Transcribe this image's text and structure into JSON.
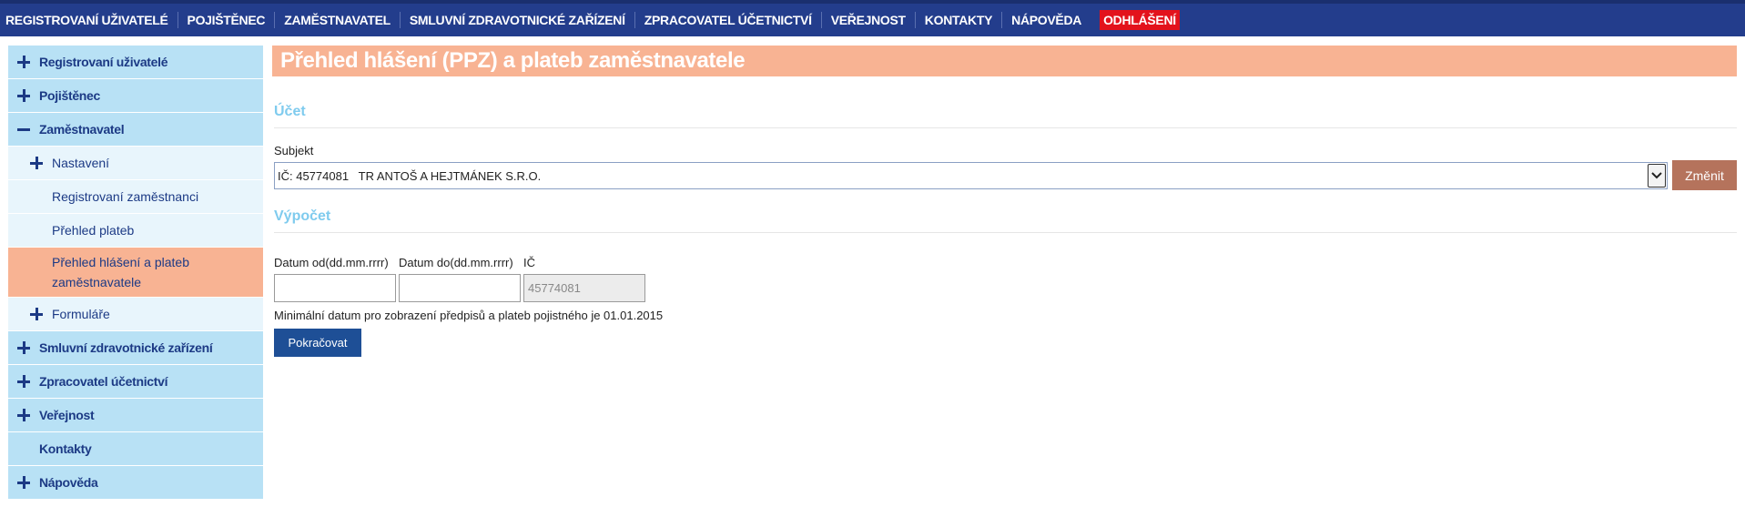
{
  "topnav": {
    "items": [
      "REGISTROVANÍ UŽIVATELÉ",
      "POJIŠTĚNEC",
      "ZAMĚSTNAVATEL",
      "SMLUVNÍ ZDRAVOTNICKÉ ZAŘÍZENÍ",
      "ZPRACOVATEL ÚČETNICTVÍ",
      "VEŘEJNOST",
      "KONTAKTY",
      "NÁPOVĚDA"
    ],
    "logout": "ODHLÁŠENÍ"
  },
  "sidebar": {
    "items": [
      {
        "label": "Registrovaní uživatelé",
        "icon": "plus-icon"
      },
      {
        "label": "Pojištěnec",
        "icon": "plus-icon"
      },
      {
        "label": "Zaměstnavatel",
        "icon": "minus-icon"
      },
      {
        "label": "Nastavení",
        "icon": "plus-icon"
      },
      {
        "label": "Registrovaní zaměstnanci"
      },
      {
        "label": "Přehled plateb"
      },
      {
        "label": "Přehled hlášení a plateb zaměstnavatele"
      },
      {
        "label": "Formuláře",
        "icon": "plus-icon"
      },
      {
        "label": "Smluvní zdravotnické zařízení",
        "icon": "plus-icon"
      },
      {
        "label": "Zpracovatel účetnictví",
        "icon": "plus-icon"
      },
      {
        "label": "Veřejnost",
        "icon": "plus-icon"
      },
      {
        "label": "Kontakty"
      },
      {
        "label": "Nápověda",
        "icon": "plus-icon"
      }
    ]
  },
  "main": {
    "title": "Přehled hlášení (PPZ) a plateb zaměstnavatele",
    "ucet": {
      "heading": "Účet",
      "subjekt_label": "Subjekt",
      "subjekt_value": "IČ: 45774081   TR ANTOŠ A HEJTMÁNEK S.R.O.",
      "change_button": "Změnit"
    },
    "vypocet": {
      "heading": "Výpočet",
      "date_from_label": "Datum od(dd.mm.rrrr)",
      "date_to_label": "Datum do(dd.mm.rrrr)",
      "ic_label": "IČ",
      "date_from_value": "",
      "date_to_value": "",
      "ic_value": "45774081",
      "hint": "Minimální datum pro zobrazení předpisů a plateb pojistného je 01.01.2015",
      "continue_button": "Pokračovat"
    }
  },
  "colors": {
    "topbar": "#233d8c",
    "logout": "#e3121c",
    "sidebar_level1": "#b8e1f5",
    "sidebar_level2": "#e8f5fc",
    "active": "#f8b393",
    "section_heading": "#7fcbee",
    "change_button": "#b5735c",
    "continue_button": "#1e4f96"
  }
}
